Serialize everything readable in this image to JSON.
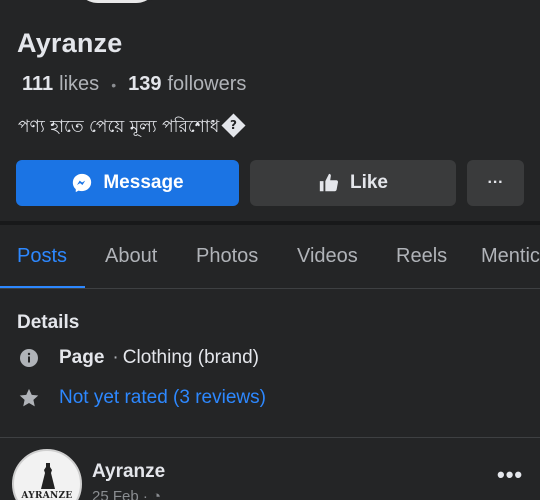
{
  "profile": {
    "name": "Ayranze",
    "likes_count": "111",
    "likes_label": "likes",
    "followers_count": "139",
    "followers_label": "followers",
    "bio": "পণ্য হাতে পেয়ে মূল্য পরিশোধ",
    "bio_emoji": "?"
  },
  "actions": {
    "message_label": "Message",
    "like_label": "Like",
    "more_label": "···"
  },
  "tabs": [
    {
      "label": "Posts",
      "active": true
    },
    {
      "label": "About"
    },
    {
      "label": "Photos"
    },
    {
      "label": "Videos"
    },
    {
      "label": "Reels"
    },
    {
      "label": "Mentic"
    }
  ],
  "details": {
    "title": "Details",
    "page_label": "Page",
    "separator": "·",
    "category": "Clothing (brand)",
    "rating": "Not yet rated (3 reviews)"
  },
  "post": {
    "author": "Ayranze",
    "avatar_text": "AYRANZE",
    "date": "25 Feb",
    "separator": "·",
    "more_label": "•••"
  },
  "colors": {
    "background": "#242526",
    "primary_button": "#1b74e4",
    "accent": "#2d88ff",
    "secondary_button": "#3a3b3c"
  }
}
